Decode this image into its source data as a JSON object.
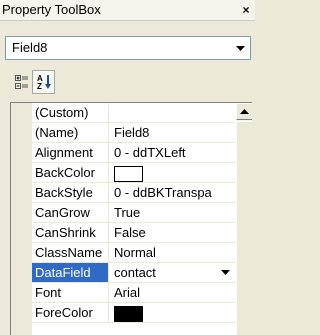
{
  "window": {
    "title": "Property ToolBox",
    "close_label": "×"
  },
  "object_selector": {
    "value": "Field8"
  },
  "toolbar": {
    "categorized_icon": "categorized-icon",
    "alphabetical_icon": "alphabetical-sort-icon"
  },
  "properties": [
    {
      "name": "(Custom)",
      "value": ""
    },
    {
      "name": "(Name)",
      "value": "Field8"
    },
    {
      "name": "Alignment",
      "value": "0 - ddTXLeft"
    },
    {
      "name": "BackColor",
      "value": "",
      "swatch": "#ffffff"
    },
    {
      "name": "BackStyle",
      "value": "0 - ddBKTranspa"
    },
    {
      "name": "CanGrow",
      "value": "True"
    },
    {
      "name": "CanShrink",
      "value": "False"
    },
    {
      "name": "ClassName",
      "value": "Normal"
    },
    {
      "name": "DataField",
      "value": "contact",
      "selected": true
    },
    {
      "name": "Font",
      "value": "Arial"
    },
    {
      "name": "ForeColor",
      "value": "",
      "swatch": "#000000"
    }
  ],
  "colors": {
    "selection": "#316ac5",
    "window_bg": "#ece9d8"
  }
}
